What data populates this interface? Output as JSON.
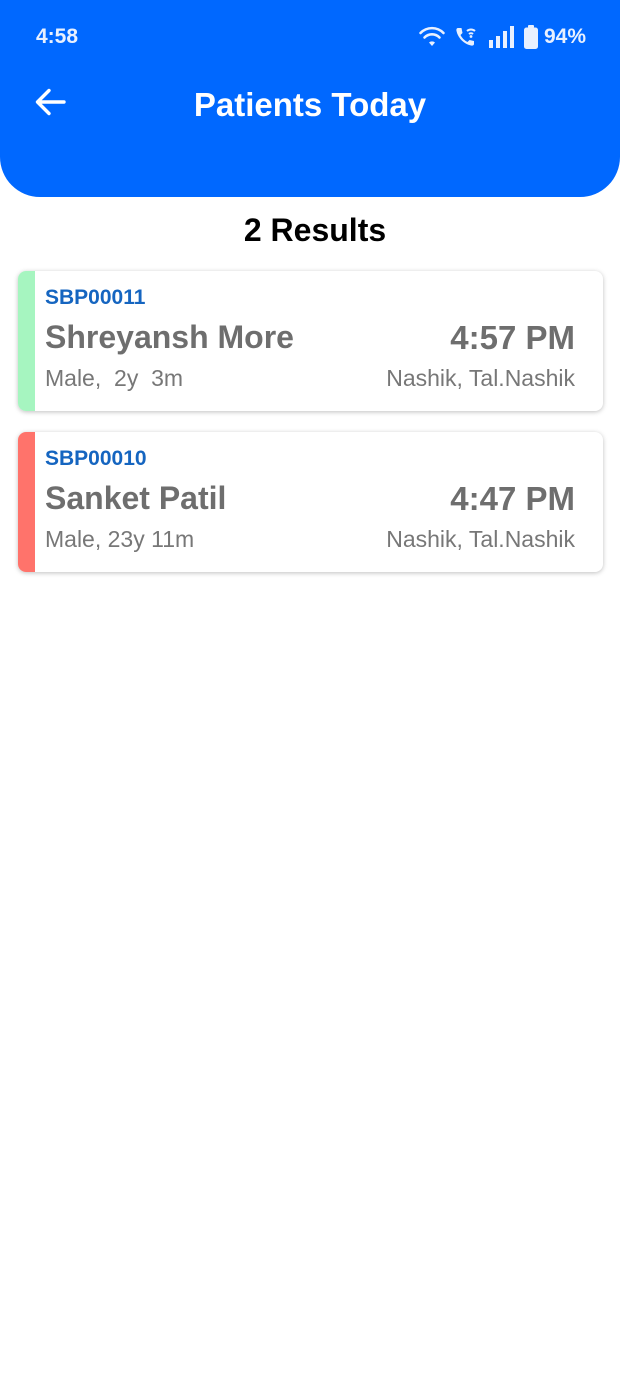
{
  "status_bar": {
    "time": "4:58",
    "battery_percent": "94%",
    "icons": [
      "wifi-icon",
      "wifi-calling-icon",
      "signal-icon",
      "battery-icon"
    ]
  },
  "header": {
    "title": "Patients Today",
    "back_icon": "arrow-left-icon",
    "background_color": "#0068ff"
  },
  "results": {
    "count_label": "2 Results"
  },
  "patients": [
    {
      "id": "SBP00011",
      "name": "Shreyansh More",
      "time": "4:57 PM",
      "info": "Male,  2y  3m",
      "location": "Nashik, Tal.Nashik",
      "status_color": "#a6f5c0"
    },
    {
      "id": "SBP00010",
      "name": "Sanket Patil",
      "time": "4:47 PM",
      "info": "Male, 23y 11m",
      "location": "Nashik, Tal.Nashik",
      "status_color": "#ff736b"
    }
  ]
}
